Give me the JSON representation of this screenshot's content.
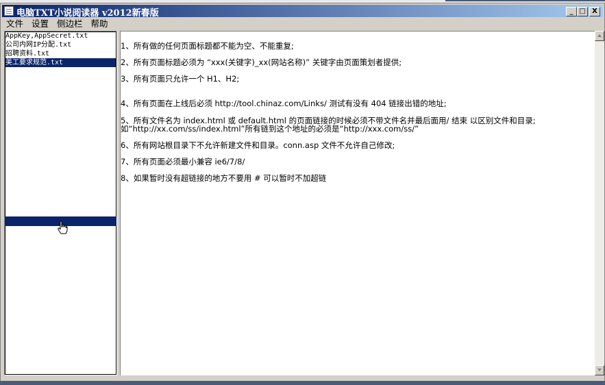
{
  "window": {
    "title": "电脑TXT小说阅读器 v2012新春版",
    "minimize_glyph": "_",
    "maximize_glyph": "□",
    "close_glyph": "X"
  },
  "menu": [
    "文件",
    "设置",
    "侧边栏",
    "帮助"
  ],
  "files": [
    {
      "name": "AppKey,AppSecret.txt",
      "selected": false
    },
    {
      "name": "公司内网IP分配.txt",
      "selected": false
    },
    {
      "name": "招聘资料.txt",
      "selected": false
    },
    {
      "name": "美工要求规范.txt",
      "selected": true
    }
  ],
  "content_lines": [
    "1、所有做的任何页面标题都不能为空、不能重复;",
    "2、所有页面标题必须为 “xxx(关键字)_xx(网站名称)” 关键字由页面策划者提供;",
    "3、所有页面只允许一个 H1、H2;",
    "4、所有页面在上线后必须 http://tool.chinaz.com/Links/  测试有没有 404 链接出错的地址;",
    "5、所有文件名为 index.html 或 default.html 的页面链接的时候必须不带文件名并最后面用/ 结束 以区别文件和目录;",
    " 如“http://xx.com/ss/index.html”所有链到这个地址的必须是“http://xxx.com/ss/”",
    "6、所有网站根目录下不允许新建文件和目录。conn.asp 文件不允许自己修改;",
    "7、所有页面必须最小兼容 ie6/7/8/",
    "8、如果暂时没有超链接的地方不要用 # 可以暂时不加超链"
  ],
  "icons": {
    "app": "document-icon",
    "cursor": "hand-cursor-icon"
  },
  "colors": {
    "selection": "#0a246a",
    "titlebar_start": "#0a246a",
    "titlebar_end": "#a6caf0"
  }
}
